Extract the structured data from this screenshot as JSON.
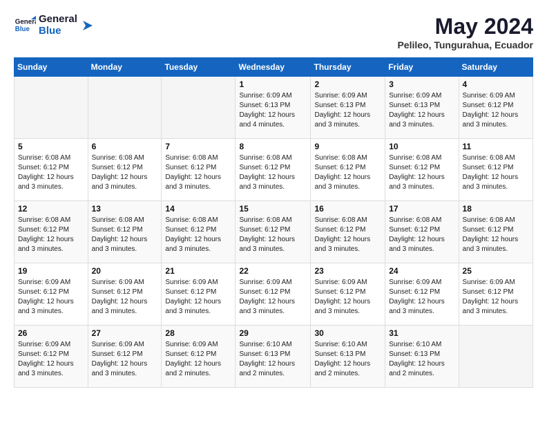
{
  "logo": {
    "line1": "General",
    "line2": "Blue"
  },
  "title": "May 2024",
  "location": "Pelileo, Tungurahua, Ecuador",
  "days_header": [
    "Sunday",
    "Monday",
    "Tuesday",
    "Wednesday",
    "Thursday",
    "Friday",
    "Saturday"
  ],
  "weeks": [
    [
      {
        "day": "",
        "sunrise": "",
        "sunset": "",
        "daylight": "",
        "empty": true
      },
      {
        "day": "",
        "sunrise": "",
        "sunset": "",
        "daylight": "",
        "empty": true
      },
      {
        "day": "",
        "sunrise": "",
        "sunset": "",
        "daylight": "",
        "empty": true
      },
      {
        "day": "1",
        "sunrise": "Sunrise: 6:09 AM",
        "sunset": "Sunset: 6:13 PM",
        "daylight": "Daylight: 12 hours and 4 minutes.",
        "empty": false
      },
      {
        "day": "2",
        "sunrise": "Sunrise: 6:09 AM",
        "sunset": "Sunset: 6:13 PM",
        "daylight": "Daylight: 12 hours and 3 minutes.",
        "empty": false
      },
      {
        "day": "3",
        "sunrise": "Sunrise: 6:09 AM",
        "sunset": "Sunset: 6:13 PM",
        "daylight": "Daylight: 12 hours and 3 minutes.",
        "empty": false
      },
      {
        "day": "4",
        "sunrise": "Sunrise: 6:09 AM",
        "sunset": "Sunset: 6:12 PM",
        "daylight": "Daylight: 12 hours and 3 minutes.",
        "empty": false
      }
    ],
    [
      {
        "day": "5",
        "sunrise": "Sunrise: 6:08 AM",
        "sunset": "Sunset: 6:12 PM",
        "daylight": "Daylight: 12 hours and 3 minutes.",
        "empty": false
      },
      {
        "day": "6",
        "sunrise": "Sunrise: 6:08 AM",
        "sunset": "Sunset: 6:12 PM",
        "daylight": "Daylight: 12 hours and 3 minutes.",
        "empty": false
      },
      {
        "day": "7",
        "sunrise": "Sunrise: 6:08 AM",
        "sunset": "Sunset: 6:12 PM",
        "daylight": "Daylight: 12 hours and 3 minutes.",
        "empty": false
      },
      {
        "day": "8",
        "sunrise": "Sunrise: 6:08 AM",
        "sunset": "Sunset: 6:12 PM",
        "daylight": "Daylight: 12 hours and 3 minutes.",
        "empty": false
      },
      {
        "day": "9",
        "sunrise": "Sunrise: 6:08 AM",
        "sunset": "Sunset: 6:12 PM",
        "daylight": "Daylight: 12 hours and 3 minutes.",
        "empty": false
      },
      {
        "day": "10",
        "sunrise": "Sunrise: 6:08 AM",
        "sunset": "Sunset: 6:12 PM",
        "daylight": "Daylight: 12 hours and 3 minutes.",
        "empty": false
      },
      {
        "day": "11",
        "sunrise": "Sunrise: 6:08 AM",
        "sunset": "Sunset: 6:12 PM",
        "daylight": "Daylight: 12 hours and 3 minutes.",
        "empty": false
      }
    ],
    [
      {
        "day": "12",
        "sunrise": "Sunrise: 6:08 AM",
        "sunset": "Sunset: 6:12 PM",
        "daylight": "Daylight: 12 hours and 3 minutes.",
        "empty": false
      },
      {
        "day": "13",
        "sunrise": "Sunrise: 6:08 AM",
        "sunset": "Sunset: 6:12 PM",
        "daylight": "Daylight: 12 hours and 3 minutes.",
        "empty": false
      },
      {
        "day": "14",
        "sunrise": "Sunrise: 6:08 AM",
        "sunset": "Sunset: 6:12 PM",
        "daylight": "Daylight: 12 hours and 3 minutes.",
        "empty": false
      },
      {
        "day": "15",
        "sunrise": "Sunrise: 6:08 AM",
        "sunset": "Sunset: 6:12 PM",
        "daylight": "Daylight: 12 hours and 3 minutes.",
        "empty": false
      },
      {
        "day": "16",
        "sunrise": "Sunrise: 6:08 AM",
        "sunset": "Sunset: 6:12 PM",
        "daylight": "Daylight: 12 hours and 3 minutes.",
        "empty": false
      },
      {
        "day": "17",
        "sunrise": "Sunrise: 6:08 AM",
        "sunset": "Sunset: 6:12 PM",
        "daylight": "Daylight: 12 hours and 3 minutes.",
        "empty": false
      },
      {
        "day": "18",
        "sunrise": "Sunrise: 6:08 AM",
        "sunset": "Sunset: 6:12 PM",
        "daylight": "Daylight: 12 hours and 3 minutes.",
        "empty": false
      }
    ],
    [
      {
        "day": "19",
        "sunrise": "Sunrise: 6:09 AM",
        "sunset": "Sunset: 6:12 PM",
        "daylight": "Daylight: 12 hours and 3 minutes.",
        "empty": false
      },
      {
        "day": "20",
        "sunrise": "Sunrise: 6:09 AM",
        "sunset": "Sunset: 6:12 PM",
        "daylight": "Daylight: 12 hours and 3 minutes.",
        "empty": false
      },
      {
        "day": "21",
        "sunrise": "Sunrise: 6:09 AM",
        "sunset": "Sunset: 6:12 PM",
        "daylight": "Daylight: 12 hours and 3 minutes.",
        "empty": false
      },
      {
        "day": "22",
        "sunrise": "Sunrise: 6:09 AM",
        "sunset": "Sunset: 6:12 PM",
        "daylight": "Daylight: 12 hours and 3 minutes.",
        "empty": false
      },
      {
        "day": "23",
        "sunrise": "Sunrise: 6:09 AM",
        "sunset": "Sunset: 6:12 PM",
        "daylight": "Daylight: 12 hours and 3 minutes.",
        "empty": false
      },
      {
        "day": "24",
        "sunrise": "Sunrise: 6:09 AM",
        "sunset": "Sunset: 6:12 PM",
        "daylight": "Daylight: 12 hours and 3 minutes.",
        "empty": false
      },
      {
        "day": "25",
        "sunrise": "Sunrise: 6:09 AM",
        "sunset": "Sunset: 6:12 PM",
        "daylight": "Daylight: 12 hours and 3 minutes.",
        "empty": false
      }
    ],
    [
      {
        "day": "26",
        "sunrise": "Sunrise: 6:09 AM",
        "sunset": "Sunset: 6:12 PM",
        "daylight": "Daylight: 12 hours and 3 minutes.",
        "empty": false
      },
      {
        "day": "27",
        "sunrise": "Sunrise: 6:09 AM",
        "sunset": "Sunset: 6:12 PM",
        "daylight": "Daylight: 12 hours and 3 minutes.",
        "empty": false
      },
      {
        "day": "28",
        "sunrise": "Sunrise: 6:09 AM",
        "sunset": "Sunset: 6:12 PM",
        "daylight": "Daylight: 12 hours and 2 minutes.",
        "empty": false
      },
      {
        "day": "29",
        "sunrise": "Sunrise: 6:10 AM",
        "sunset": "Sunset: 6:13 PM",
        "daylight": "Daylight: 12 hours and 2 minutes.",
        "empty": false
      },
      {
        "day": "30",
        "sunrise": "Sunrise: 6:10 AM",
        "sunset": "Sunset: 6:13 PM",
        "daylight": "Daylight: 12 hours and 2 minutes.",
        "empty": false
      },
      {
        "day": "31",
        "sunrise": "Sunrise: 6:10 AM",
        "sunset": "Sunset: 6:13 PM",
        "daylight": "Daylight: 12 hours and 2 minutes.",
        "empty": false
      },
      {
        "day": "",
        "sunrise": "",
        "sunset": "",
        "daylight": "",
        "empty": true
      }
    ]
  ]
}
